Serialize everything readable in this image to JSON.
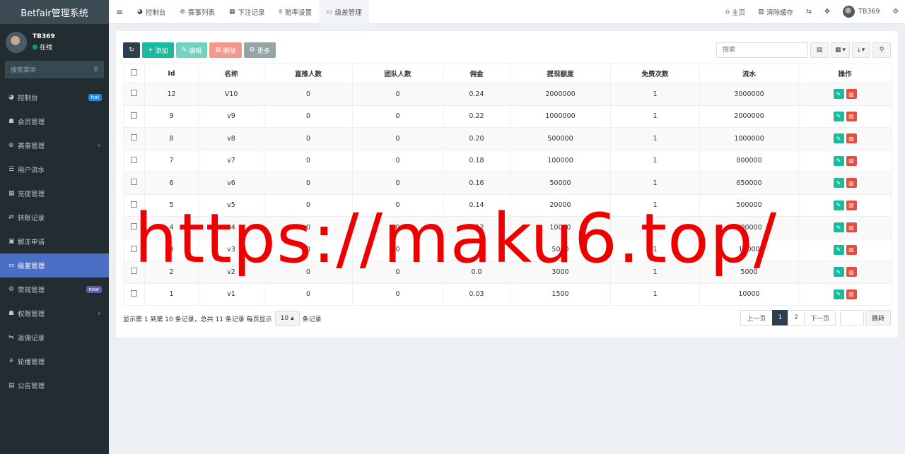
{
  "app": {
    "brand": "Betfair管理系统"
  },
  "user": {
    "name": "TB369",
    "status": "在线"
  },
  "sidebar": {
    "search_placeholder": "搜索菜单",
    "items": [
      {
        "icon": "dashboard-icon",
        "glyph": "◕",
        "label": "控制台",
        "badge": "hot"
      },
      {
        "icon": "users-icon",
        "glyph": "☗",
        "label": "会员管理"
      },
      {
        "icon": "globe-icon",
        "glyph": "⊕",
        "label": "赛事管理",
        "chevron": "‹"
      },
      {
        "icon": "list-icon",
        "glyph": "☰",
        "label": "用户流水"
      },
      {
        "icon": "table-icon",
        "glyph": "▦",
        "label": "充提管理"
      },
      {
        "icon": "transfer-icon",
        "glyph": "⇄",
        "label": "转账记录"
      },
      {
        "icon": "unlock-icon",
        "glyph": "▣",
        "label": "解冻申请"
      },
      {
        "icon": "card-icon",
        "glyph": "▭",
        "label": "级差管理",
        "active": true
      },
      {
        "icon": "cogs-icon",
        "glyph": "⚙",
        "label": "常规管理",
        "badge": "new"
      },
      {
        "icon": "group-icon",
        "glyph": "☗",
        "label": "权限管理",
        "chevron": "‹"
      },
      {
        "icon": "return-icon",
        "glyph": "⇋",
        "label": "返佣记录"
      },
      {
        "icon": "image-icon",
        "glyph": "⚘",
        "label": "轮播管理"
      },
      {
        "icon": "notice-icon",
        "glyph": "▤",
        "label": "公告管理"
      }
    ]
  },
  "topbar": {
    "tabs": [
      {
        "icon": "dashboard-icon",
        "glyph": "◕",
        "label": "控制台"
      },
      {
        "icon": "globe-icon",
        "glyph": "⊕",
        "label": "赛事列表"
      },
      {
        "icon": "calendar-icon",
        "glyph": "▦",
        "label": "下注记录"
      },
      {
        "icon": "vk-icon",
        "glyph": "ʬ",
        "label": "赔率设置"
      },
      {
        "icon": "card-icon",
        "glyph": "▭",
        "label": "级差管理",
        "active": true
      }
    ],
    "home": "主页",
    "clear_cache": "清除缓存",
    "user": "TB369"
  },
  "toolbar": {
    "add": "添加",
    "edit": "编辑",
    "delete": "删除",
    "more": "更多",
    "search_placeholder": "搜索"
  },
  "table": {
    "columns": [
      "Id",
      "名称",
      "直推人数",
      "团队人数",
      "佣金",
      "提现额度",
      "免费次数",
      "流水",
      "操作"
    ],
    "rows": [
      [
        "12",
        "V10",
        "0",
        "0",
        "0.24",
        "2000000",
        "1",
        "3000000"
      ],
      [
        "9",
        "v9",
        "0",
        "0",
        "0.22",
        "1000000",
        "1",
        "2000000"
      ],
      [
        "8",
        "v8",
        "0",
        "0",
        "0.20",
        "500000",
        "1",
        "1000000"
      ],
      [
        "7",
        "v7",
        "0",
        "0",
        "0.18",
        "100000",
        "1",
        "800000"
      ],
      [
        "6",
        "v6",
        "0",
        "0",
        "0.16",
        "50000",
        "1",
        "650000"
      ],
      [
        "5",
        "v5",
        "0",
        "0",
        "0.14",
        "20000",
        "1",
        "500000"
      ],
      [
        "4",
        "v4",
        "0",
        "0",
        "0.12",
        "10000",
        "1",
        "200000"
      ],
      [
        "3",
        "v3",
        "0",
        "0",
        "",
        "5000",
        "1",
        "10000"
      ],
      [
        "2",
        "v2",
        "0",
        "0",
        "0.0",
        "3000",
        "1",
        "5000"
      ],
      [
        "1",
        "v1",
        "0",
        "0",
        "0.03",
        "1500",
        "1",
        "10000"
      ]
    ]
  },
  "pagination": {
    "info_prefix": "显示第 1 到第 10 条记录，总共 11 条记录 每页显示",
    "page_size": "10",
    "info_suffix": "条记录",
    "prev": "上一页",
    "pages": [
      "1",
      "2"
    ],
    "next": "下一页",
    "go": "跳转"
  },
  "watermark": "https://maku6.top/"
}
